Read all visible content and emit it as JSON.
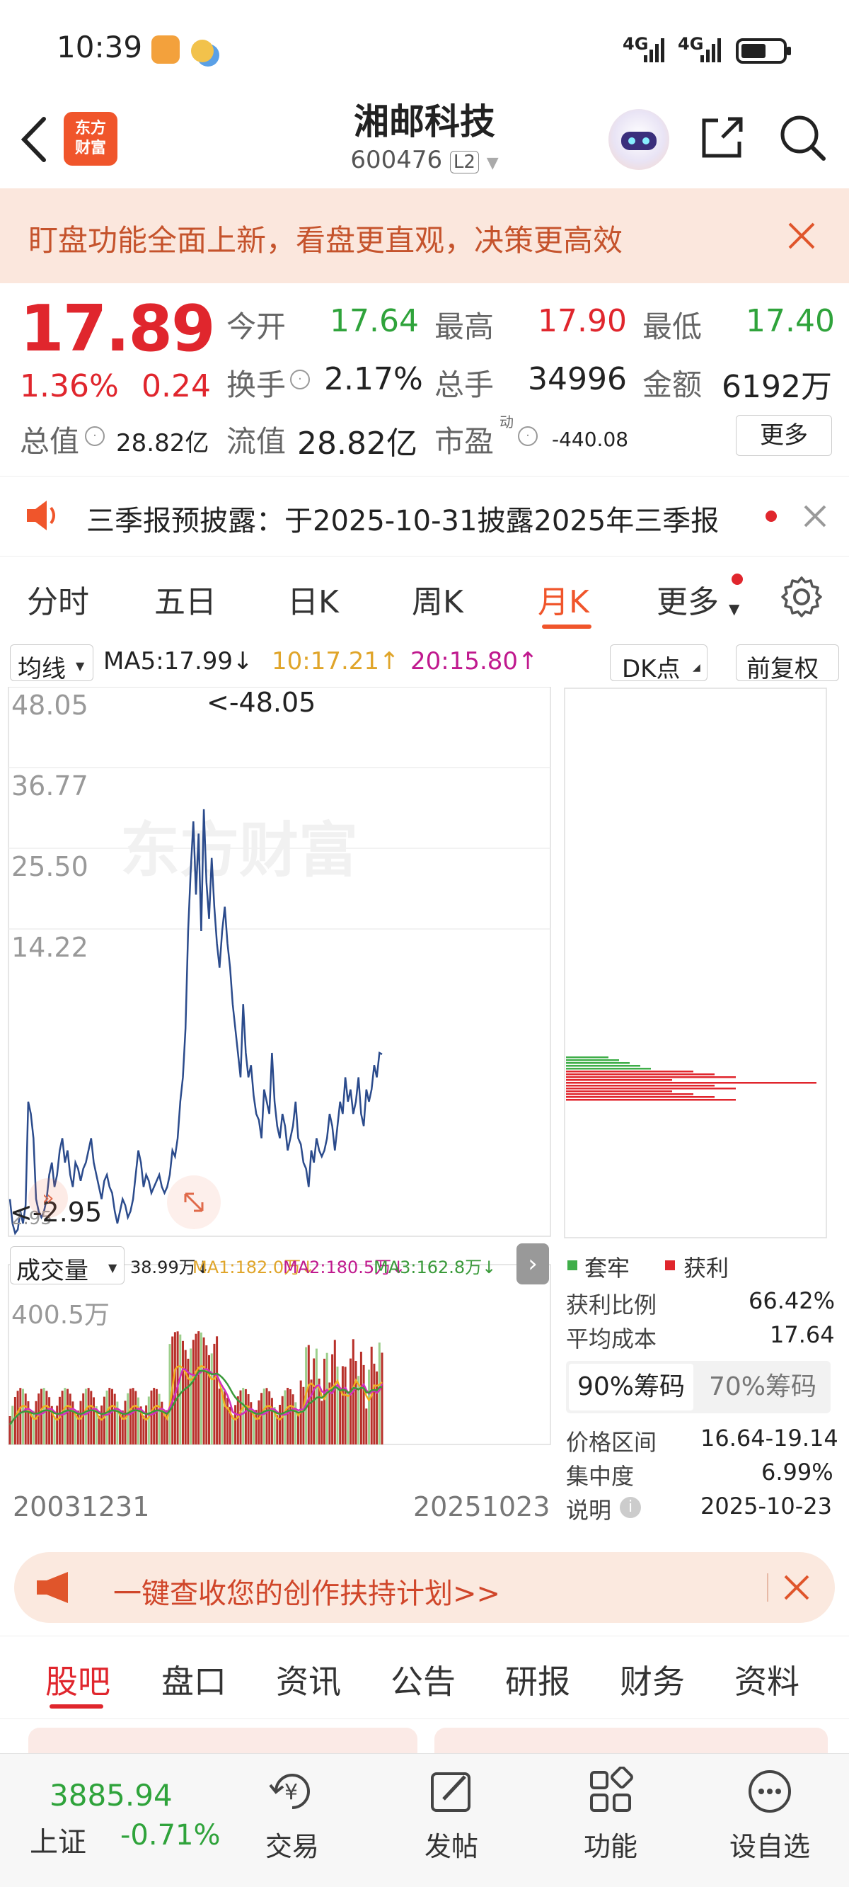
{
  "status_bar": {
    "time": "10:39",
    "net1": "4G",
    "net2": "4G"
  },
  "header": {
    "title": "湘邮科技",
    "code": "600476",
    "level": "L2",
    "logo_line1": "东方",
    "logo_line2": "财富"
  },
  "banner": {
    "text": "盯盘功能全面上新，看盘更直观，决策更高效"
  },
  "quote": {
    "price": "17.89",
    "change_pct": "1.36%",
    "change": "0.24",
    "open_label": "今开",
    "open": "17.64",
    "high_label": "最高",
    "high": "17.90",
    "low_label": "最低",
    "low": "17.40",
    "turnover_label": "换手",
    "turnover": "2.17%",
    "volume_label": "总手",
    "volume": "34996",
    "amount_label": "金额",
    "amount": "6192万",
    "mktcap_label": "总值",
    "mktcap": "28.82亿",
    "float_label": "流值",
    "float": "28.82亿",
    "pe_label": "市盈",
    "pe_sup": "动",
    "pe": "-440.08",
    "more": "更多"
  },
  "notice": {
    "text": "三季报预披露：于2025-10-31披露2025年三季报"
  },
  "tabs": [
    "分时",
    "五日",
    "日K",
    "周K",
    "月K",
    "更多"
  ],
  "chart": {
    "ma_label": "均线",
    "ma5": "MA5:17.99↓",
    "ma10": "10:17.21↑",
    "ma20": "20:15.80↑",
    "dk": "DK点",
    "fq": "前复权",
    "y_ticks": [
      "48.05",
      "36.77",
      "25.50",
      "14.22"
    ],
    "y_min": "2.95",
    "max_marker": "<-48.05",
    "min_marker": "<-2.95",
    "vol_label": "成交量",
    "vol_value": "38.99万↓",
    "vol_ma1": "MA1:182.0万↓",
    "vol_ma2": "MA2:180.5万↓",
    "vol_ma3": "MA3:162.8万↓",
    "vol_max": "400.5万",
    "date_start": "20031231",
    "date_end": "20251023",
    "watermark": "东方财富",
    "colors": {
      "line": "#2b4b8c",
      "up": "#b8302a",
      "ma1": "#f0b020",
      "ma2": "#d02fbd",
      "ma3": "#3a9a3a"
    }
  },
  "chip": {
    "legend_trap": "套牢",
    "legend_profit": "获利",
    "profit_ratio_label": "获利比例",
    "profit_ratio": "66.42%",
    "avg_cost_label": "平均成本",
    "avg_cost": "17.64",
    "tab90": "90%筹码",
    "tab70": "70%筹码",
    "range_label": "价格区间",
    "range": "16.64-19.14",
    "conc_label": "集中度",
    "conc": "6.99%",
    "note_label": "说明",
    "note_date": "2025-10-23"
  },
  "bottom_banner": {
    "text": "一键查收您的创作扶持计划>>"
  },
  "subtabs": [
    "股吧",
    "盘口",
    "资讯",
    "公告",
    "研报",
    "财务",
    "资料"
  ],
  "footer": {
    "index_value": "3885.94",
    "index_name": "上证",
    "index_change": "-0.71%",
    "items": [
      "交易",
      "发帖",
      "功能",
      "设自选"
    ]
  }
}
